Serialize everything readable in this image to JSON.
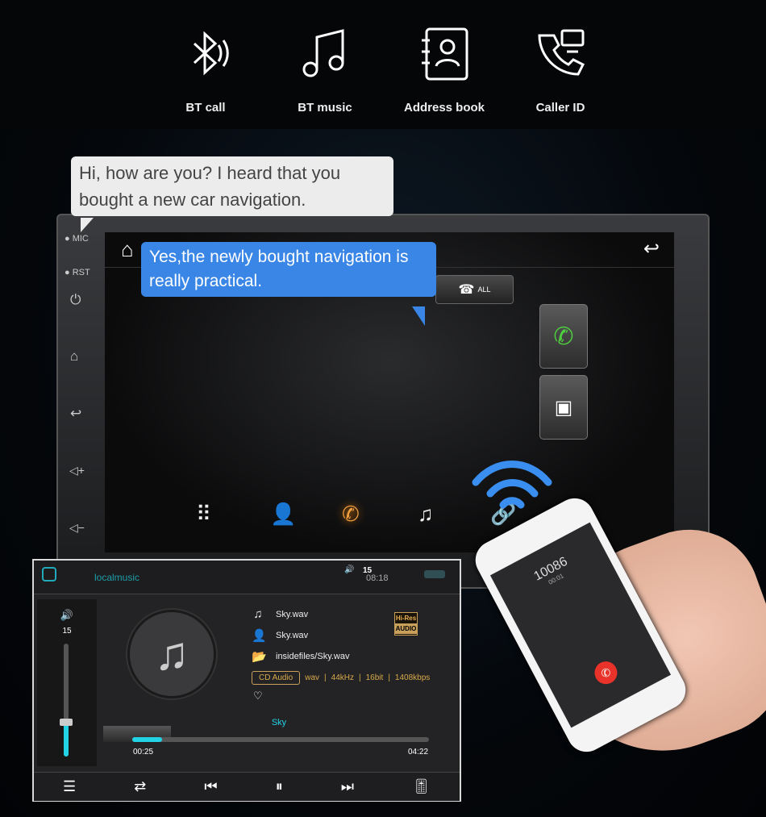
{
  "features": [
    {
      "icon": "bluetooth-icon",
      "label": "BT call"
    },
    {
      "icon": "music-note-icon",
      "label": "BT music"
    },
    {
      "icon": "address-book-icon",
      "label": "Address book"
    },
    {
      "icon": "caller-id-icon",
      "label": "Caller ID"
    }
  ],
  "bubbles": {
    "grey": "Hi, how are you? I heard that you bought a new car navigation.",
    "blue": "Yes,the newly bought navigation is really practical."
  },
  "head_unit": {
    "side_labels": {
      "mic": "MIC",
      "rst": "RST"
    },
    "all_button": "ALL",
    "dock": [
      "dialpad-icon",
      "contacts-icon",
      "call-log-icon",
      "music-icon",
      "link-icon"
    ],
    "active_dock": "call-log-icon"
  },
  "music_player": {
    "app_title": "localmusic",
    "status_volume": "15",
    "clock": "08:18",
    "volume_level": "15",
    "volume_max_fraction": 0.3,
    "title": "Sky.wav",
    "artist": "Sky.wav",
    "path": "insidefiles/Sky.wav",
    "quality_badge": "CD Audio",
    "format": "wav",
    "sample_rate": "44kHz",
    "bit_depth": "16bit",
    "bitrate": "1408kbps",
    "hires_top": "Hi-Res",
    "hires_bottom": "AUDIO",
    "lyric": "Sky",
    "elapsed": "00:25",
    "duration": "04:22",
    "progress_percent": 10,
    "accent": "#22d3e6"
  },
  "phone": {
    "number": "10086",
    "timer": "00:01"
  }
}
